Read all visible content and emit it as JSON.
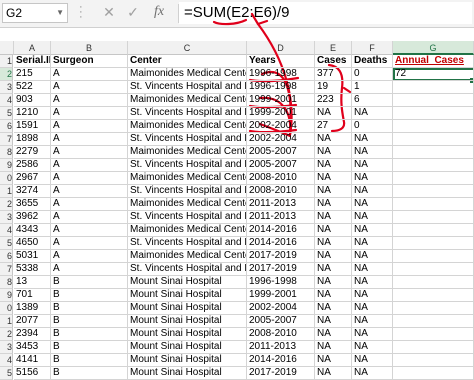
{
  "formula_bar": {
    "name_box": "G2",
    "formula": "=SUM(E2:E6)/9",
    "icons": [
      "cancel-icon",
      "enter-icon",
      "fx-icon"
    ]
  },
  "columns": [
    "A",
    "B",
    "C",
    "D",
    "E",
    "F",
    "G"
  ],
  "rows": [
    {
      "num": "1",
      "cells": [
        "Serial.ID",
        "Surgeon",
        "Center",
        "Years",
        "Cases",
        "Deaths",
        "Annual_Cases"
      ]
    },
    {
      "num": "2",
      "cells": [
        "215",
        "A",
        "Maimonides Medical Center",
        "1996-1998",
        "377",
        "0",
        "72"
      ]
    },
    {
      "num": "3",
      "cells": [
        "522",
        "A",
        "St. Vincents Hospital and Medica",
        "1996-1998",
        "19",
        "1",
        ""
      ]
    },
    {
      "num": "4",
      "cells": [
        "903",
        "A",
        "Maimonides Medical Center",
        "1999-2001",
        "223",
        "6",
        ""
      ]
    },
    {
      "num": "5",
      "cells": [
        "1210",
        "A",
        "St. Vincents Hospital and Medica",
        "1999-2001",
        "NA",
        "NA",
        ""
      ]
    },
    {
      "num": "6",
      "cells": [
        "1591",
        "A",
        "Maimonides Medical Center",
        "2002-2004",
        "27",
        "0",
        ""
      ]
    },
    {
      "num": "7",
      "cells": [
        "1898",
        "A",
        "St. Vincents Hospital and Medica",
        "2002-2004",
        "NA",
        "NA",
        ""
      ]
    },
    {
      "num": "8",
      "cells": [
        "2279",
        "A",
        "Maimonides Medical Center",
        "2005-2007",
        "NA",
        "NA",
        ""
      ]
    },
    {
      "num": "9",
      "cells": [
        "2586",
        "A",
        "St. Vincents Hospital and Medica",
        "2005-2007",
        "NA",
        "NA",
        ""
      ]
    },
    {
      "num": "0",
      "cells": [
        "2967",
        "A",
        "Maimonides Medical Center",
        "2008-2010",
        "NA",
        "NA",
        ""
      ]
    },
    {
      "num": "1",
      "cells": [
        "3274",
        "A",
        "St. Vincents Hospital and Medica",
        "2008-2010",
        "NA",
        "NA",
        ""
      ]
    },
    {
      "num": "2",
      "cells": [
        "3655",
        "A",
        "Maimonides Medical Center",
        "2011-2013",
        "NA",
        "NA",
        ""
      ]
    },
    {
      "num": "3",
      "cells": [
        "3962",
        "A",
        "St. Vincents Hospital and Medica",
        "2011-2013",
        "NA",
        "NA",
        ""
      ]
    },
    {
      "num": "4",
      "cells": [
        "4343",
        "A",
        "Maimonides Medical Center",
        "2014-2016",
        "NA",
        "NA",
        ""
      ]
    },
    {
      "num": "5",
      "cells": [
        "4650",
        "A",
        "St. Vincents Hospital and Medica",
        "2014-2016",
        "NA",
        "NA",
        ""
      ]
    },
    {
      "num": "6",
      "cells": [
        "5031",
        "A",
        "Maimonides Medical Center",
        "2017-2019",
        "NA",
        "NA",
        ""
      ]
    },
    {
      "num": "7",
      "cells": [
        "5338",
        "A",
        "St. Vincents Hospital and Medica",
        "2017-2019",
        "NA",
        "NA",
        ""
      ]
    },
    {
      "num": "8",
      "cells": [
        "13",
        "B",
        "Mount Sinai Hospital",
        "1996-1998",
        "NA",
        "NA",
        ""
      ]
    },
    {
      "num": "9",
      "cells": [
        "701",
        "B",
        "Mount Sinai Hospital",
        "1999-2001",
        "NA",
        "NA",
        ""
      ]
    },
    {
      "num": "0",
      "cells": [
        "1389",
        "B",
        "Mount Sinai Hospital",
        "2002-2004",
        "NA",
        "NA",
        ""
      ]
    },
    {
      "num": "1",
      "cells": [
        "2077",
        "B",
        "Mount Sinai Hospital",
        "2005-2007",
        "NA",
        "NA",
        ""
      ]
    },
    {
      "num": "2",
      "cells": [
        "2394",
        "B",
        "Mount Sinai Hospital",
        "2008-2010",
        "NA",
        "NA",
        ""
      ]
    },
    {
      "num": "3",
      "cells": [
        "3453",
        "B",
        "Mount Sinai Hospital",
        "2011-2013",
        "NA",
        "NA",
        ""
      ]
    },
    {
      "num": "4",
      "cells": [
        "4141",
        "B",
        "Mount Sinai Hospital",
        "2014-2016",
        "NA",
        "NA",
        ""
      ]
    },
    {
      "num": "5",
      "cells": [
        "5156",
        "B",
        "Mount Sinai Hospital",
        "2017-2019",
        "NA",
        "NA",
        ""
      ]
    }
  ],
  "colors": {
    "accent": "#217346",
    "annotation": "#e0001b",
    "header_red": "#c00000"
  }
}
